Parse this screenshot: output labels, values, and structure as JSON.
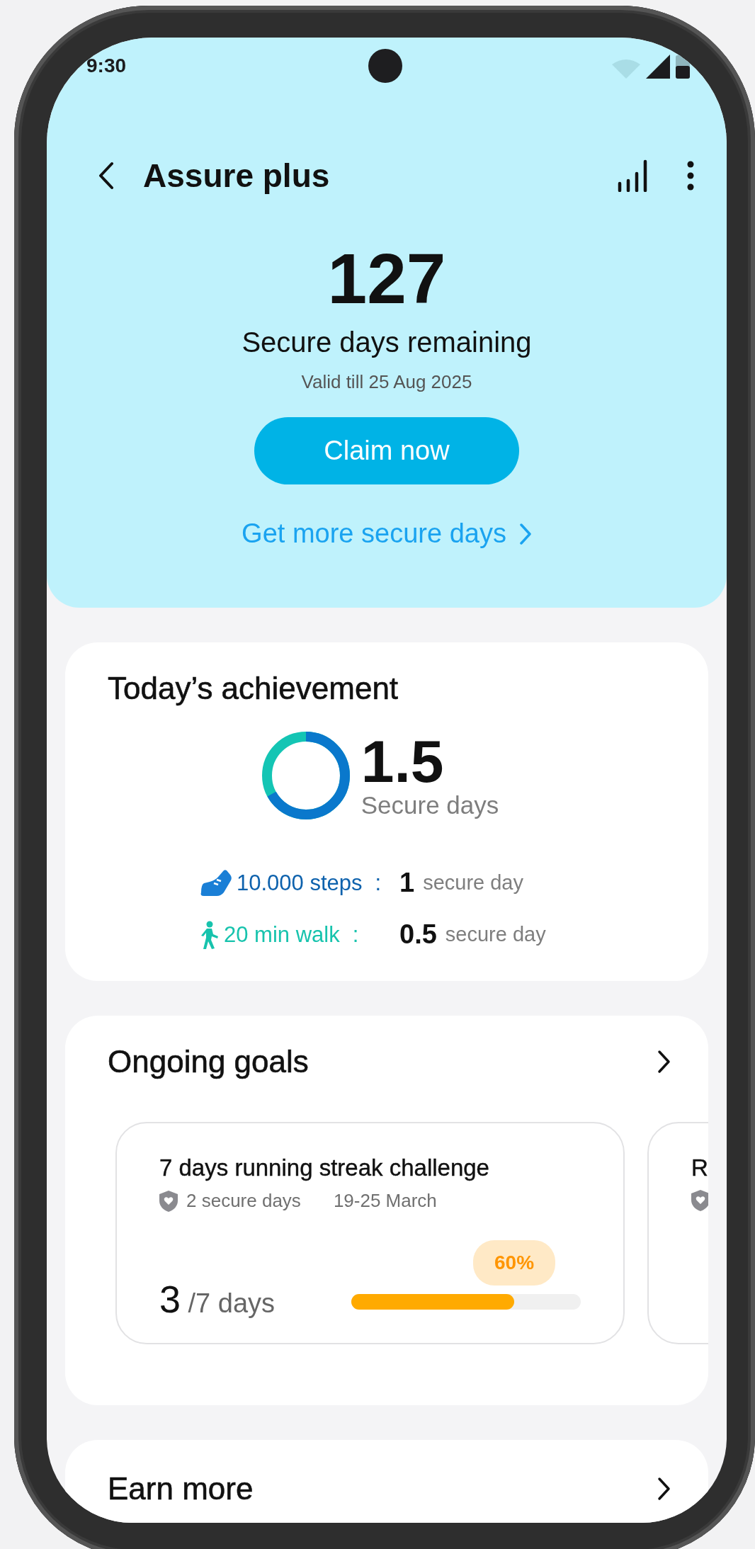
{
  "status_bar": {
    "time": "9:30"
  },
  "header": {
    "title": "Assure plus"
  },
  "summary": {
    "count": "127",
    "label": "Secure days remaining",
    "validity": "Valid till 25 Aug 2025",
    "claim_button": "Claim now",
    "more_link": "Get more secure days"
  },
  "achievement": {
    "title": "Today’s achievement",
    "total": "1.5",
    "unit": "Secure days",
    "activities": [
      {
        "kind": "steps",
        "label": "10.000 steps",
        "separator": ":",
        "value": "1",
        "unit": "secure day",
        "color": "#0e62ad"
      },
      {
        "kind": "walk",
        "label": "20 min walk",
        "separator": ":",
        "value": "0.5",
        "unit": "secure day",
        "color": "#17c3ad"
      }
    ]
  },
  "goals": {
    "title": "Ongoing goals",
    "cards": [
      {
        "title": "7 days running streak challenge",
        "reward": "2 secure days",
        "dates": "19-25 March",
        "done": "3",
        "total": "/7 days",
        "percent": "60%",
        "level": 0.71
      },
      {
        "title": "R"
      }
    ]
  },
  "earn_more": {
    "title": "Earn more"
  }
}
